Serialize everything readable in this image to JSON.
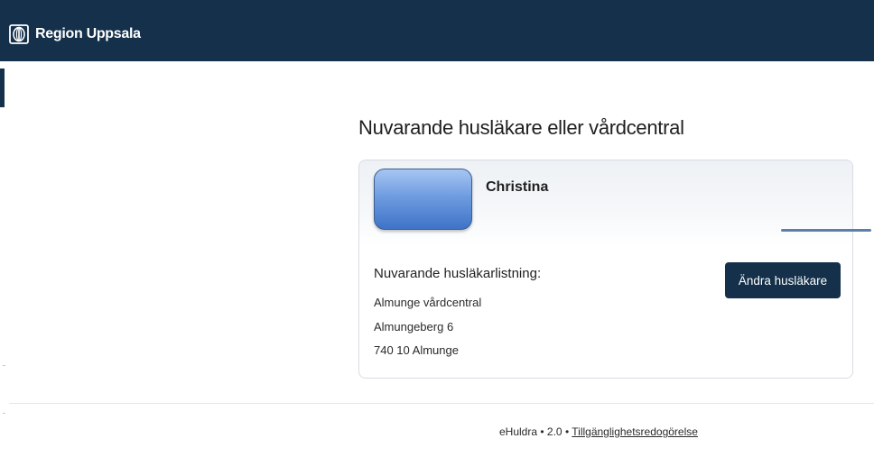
{
  "header": {
    "brand_name": "Region Uppsala",
    "logo_icon": "region-uppsala-logo-icon",
    "background_color": "#14304a"
  },
  "main": {
    "title": "Nuvarande husläkare eller vårdcentral",
    "card": {
      "avatar_icon": "profile-image-placeholder",
      "person_name": "Christina",
      "listing_heading": "Nuvarande husläkarlistning:",
      "address": {
        "clinic": "Almunge vårdcentral",
        "street": "Almungeberg 6",
        "postal": "740 10 Almunge"
      },
      "change_button_label": "Ändra husläkare"
    }
  },
  "footer": {
    "app_name": "eHuldra",
    "separator": "•",
    "version": "2.0",
    "accessibility_link": "Tillgänglighetsredogörelse"
  }
}
